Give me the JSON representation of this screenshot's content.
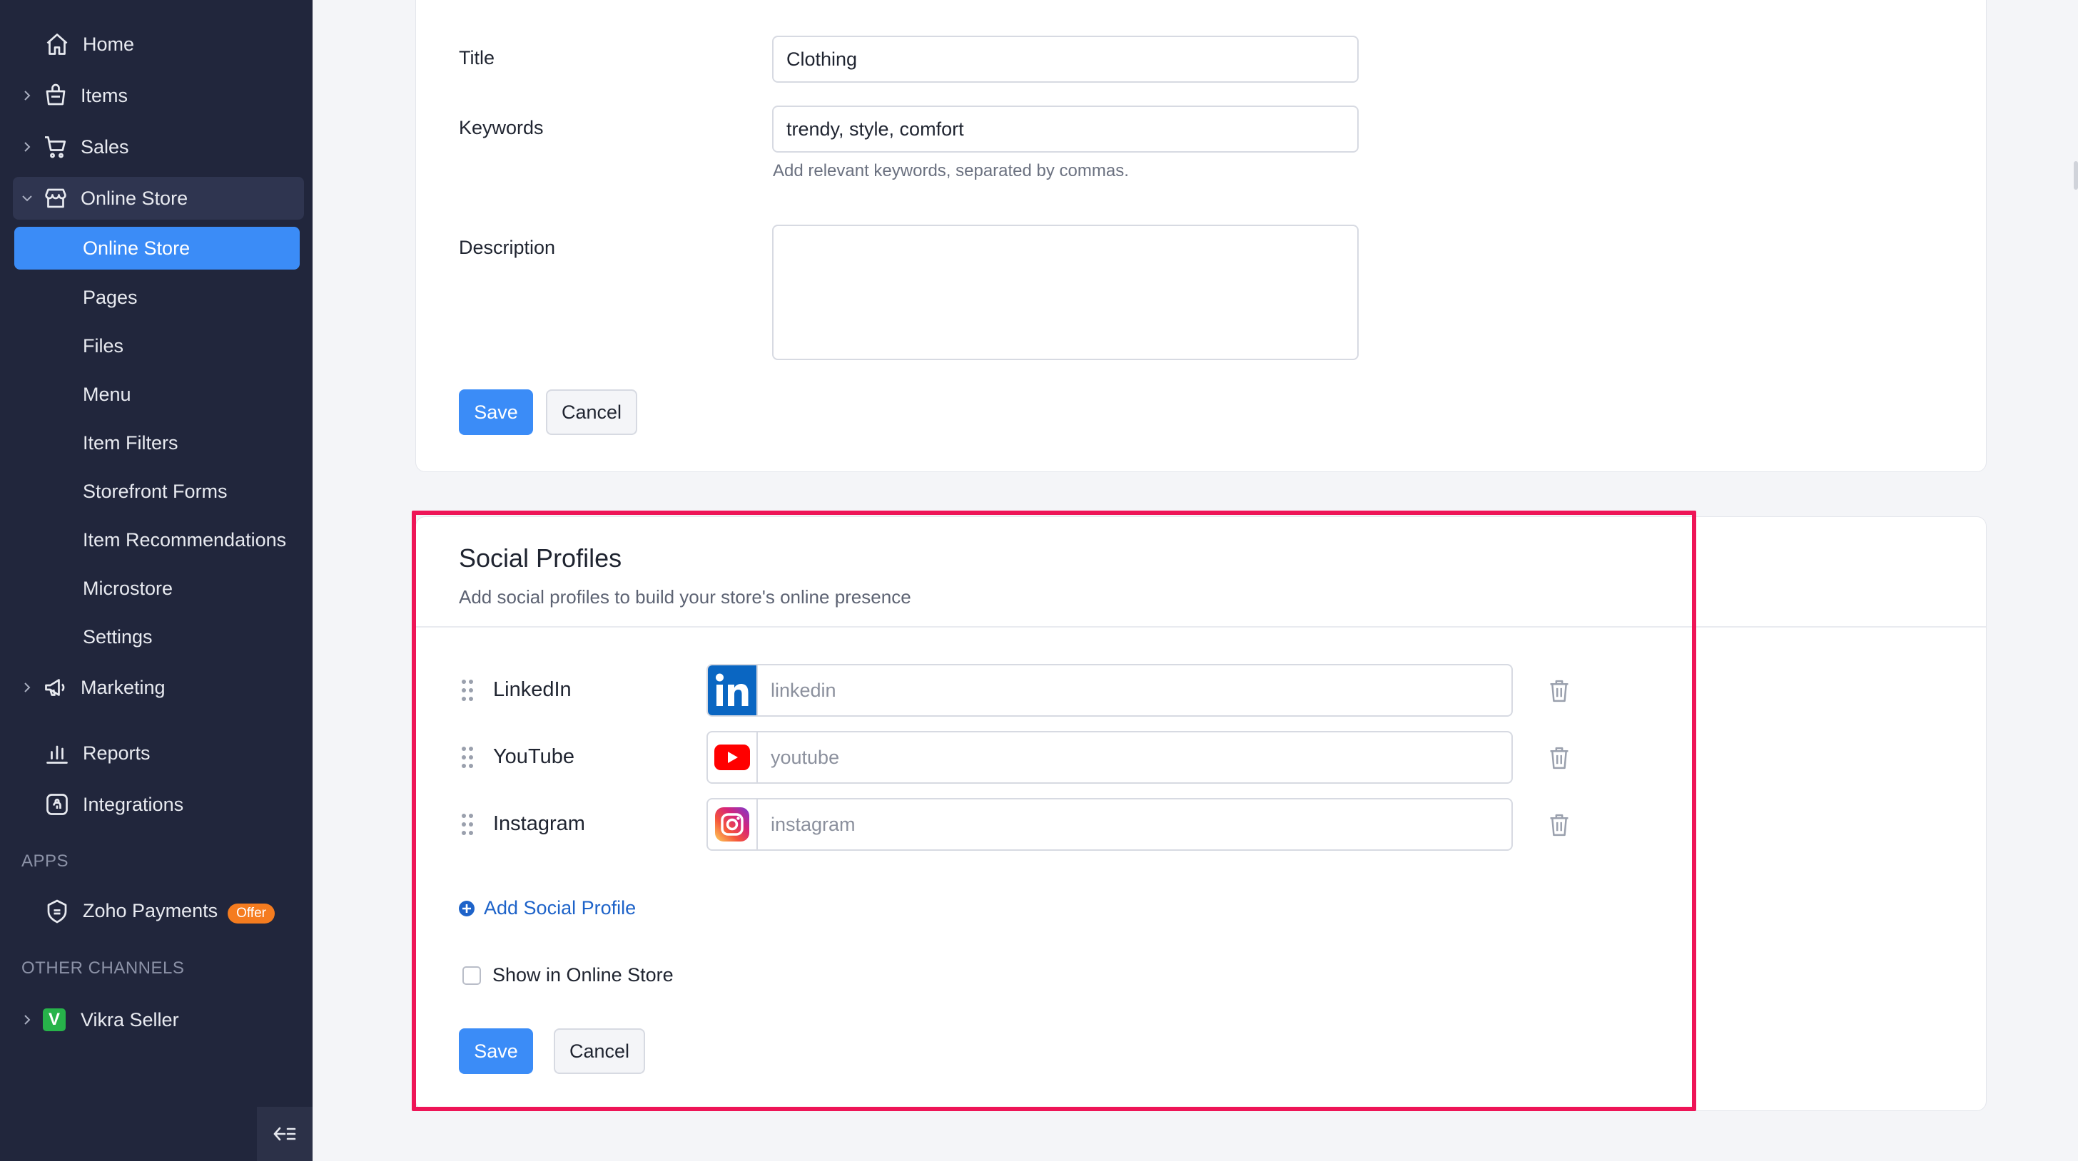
{
  "sidebar": {
    "home": "Home",
    "items": "Items",
    "sales": "Sales",
    "online_store": "Online Store",
    "online_store_sub": [
      "Online Store",
      "Pages",
      "Files",
      "Menu",
      "Item Filters",
      "Storefront Forms",
      "Item Recommendations",
      "Microstore",
      "Settings"
    ],
    "marketing": "Marketing",
    "reports": "Reports",
    "integrations": "Integrations",
    "apps_heading": "APPS",
    "zoho_payments": "Zoho Payments",
    "offer_badge": "Offer",
    "other_channels_heading": "OTHER CHANNELS",
    "vikra_seller": "Vikra Seller",
    "vikra_logo_letter": "V"
  },
  "seo_form": {
    "title_label": "Title",
    "title_value": "Clothing",
    "keywords_label": "Keywords",
    "keywords_value": "trendy, style, comfort",
    "keywords_helper": "Add relevant keywords, separated by commas.",
    "description_label": "Description",
    "description_value": "",
    "save_label": "Save",
    "cancel_label": "Cancel"
  },
  "social_profiles": {
    "title": "Social Profiles",
    "subtitle": "Add social profiles to build your store's online presence",
    "profiles": [
      {
        "name": "LinkedIn",
        "placeholder": "linkedin",
        "icon": "linkedin-logo-icon",
        "color": "#0a66c2"
      },
      {
        "name": "YouTube",
        "placeholder": "youtube",
        "icon": "youtube-logo-icon",
        "color": "#ff0000"
      },
      {
        "name": "Instagram",
        "placeholder": "instagram",
        "icon": "instagram-logo-icon",
        "color": "#e1306c"
      }
    ],
    "add_label": "Add Social Profile",
    "show_in_store_label": "Show in Online Store",
    "show_in_store_checked": false,
    "save_label": "Save",
    "cancel_label": "Cancel"
  },
  "colors": {
    "sidebar_bg": "#21263c",
    "accent": "#3b8cf7",
    "highlight": "#ee1557",
    "offer": "#f57c1f"
  }
}
